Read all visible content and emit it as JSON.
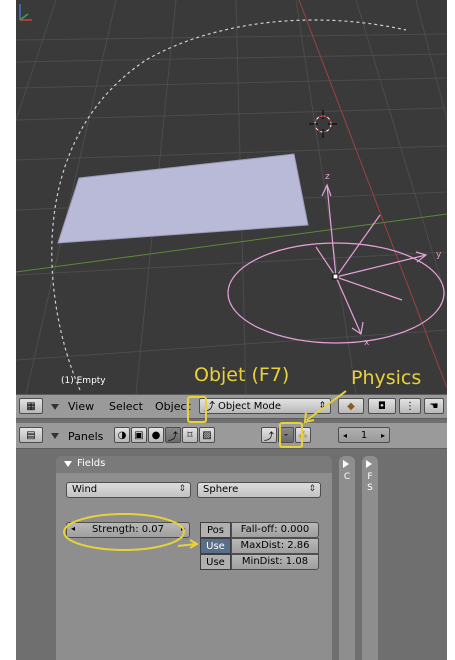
{
  "viewport": {
    "object_label": "(1) Empty",
    "axes": {
      "x": "x",
      "y": "y",
      "z": "z"
    }
  },
  "header1": {
    "menus": {
      "view": "View",
      "select": "Select",
      "object": "Object"
    },
    "mode_dropdown": "Object Mode"
  },
  "header2": {
    "panels_label": "Panels",
    "frame_value": "1"
  },
  "fields_panel": {
    "title": "Fields",
    "type_select": "Wind",
    "shape_select": "Sphere",
    "strength": "Strength: 0.07",
    "pos_btn": "Pos",
    "falloff": "Fall-off: 0.000",
    "use1": "Use",
    "maxdist": "MaxDist: 2.86",
    "use2": "Use",
    "mindist": "MinDist: 1.08"
  },
  "side_tabs": {
    "c_label": "C",
    "fs_label_1": "F",
    "fs_label_2": "S"
  },
  "annotations": {
    "objet": "Objet (F7)",
    "physics": "Physics"
  },
  "colors": {
    "annotation": "#e8d23a",
    "plane": "#b8b8d8",
    "empty_pink": "#e6a0d8"
  }
}
